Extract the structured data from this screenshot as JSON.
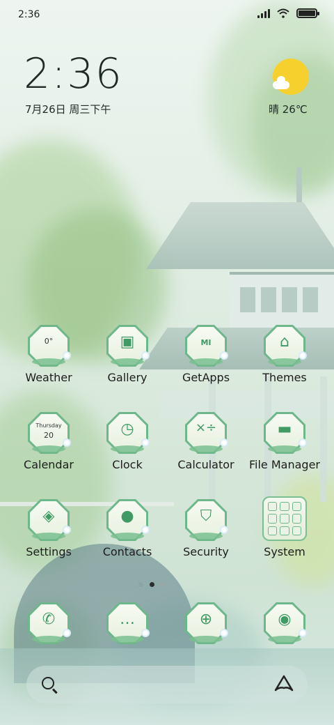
{
  "status_bar": {
    "time": "2:36",
    "icons": [
      "signal-icon",
      "wifi-icon",
      "battery-icon"
    ],
    "battery_level": 1.0
  },
  "clock_widget": {
    "time": "2:36",
    "date": "7月26日 周三下午"
  },
  "weather_widget": {
    "icon": "sunny-cloudy-icon",
    "text": "晴 26℃"
  },
  "apps": [
    {
      "label": "Weather",
      "icon": "weather-icon",
      "glyph": "0°"
    },
    {
      "label": "Gallery",
      "icon": "gallery-icon",
      "glyph": "▣"
    },
    {
      "label": "GetApps",
      "icon": "getapps-icon",
      "glyph": "MI"
    },
    {
      "label": "Themes",
      "icon": "themes-icon",
      "glyph": "⌂"
    },
    {
      "label": "Calendar",
      "icon": "calendar-icon",
      "glyph_day": "Thursday",
      "glyph_date": "20"
    },
    {
      "label": "Clock",
      "icon": "clock-icon",
      "glyph": "◷"
    },
    {
      "label": "Calculator",
      "icon": "calculator-icon",
      "glyph": "×÷"
    },
    {
      "label": "File Manager",
      "icon": "folder-icon",
      "glyph": "▬"
    },
    {
      "label": "Settings",
      "icon": "settings-icon",
      "glyph": "◈"
    },
    {
      "label": "Contacts",
      "icon": "contacts-icon",
      "glyph": "●"
    },
    {
      "label": "Security",
      "icon": "shield-icon",
      "glyph": "⛉"
    },
    {
      "label": "System",
      "icon": "folder-grid-icon"
    }
  ],
  "pager": {
    "pages": 2,
    "current": 1
  },
  "dock": [
    {
      "icon": "phone-icon",
      "glyph": "✆"
    },
    {
      "icon": "messages-icon",
      "glyph": "…"
    },
    {
      "icon": "browser-icon",
      "glyph": "⊕"
    },
    {
      "icon": "camera-icon",
      "glyph": "◉"
    }
  ],
  "search_bar": {
    "left_icon": "search-icon",
    "right_icon": "assistant-icon"
  },
  "colors": {
    "accent": "#6db78a",
    "sun": "#f6d12e",
    "text": "#1c1c1c"
  }
}
